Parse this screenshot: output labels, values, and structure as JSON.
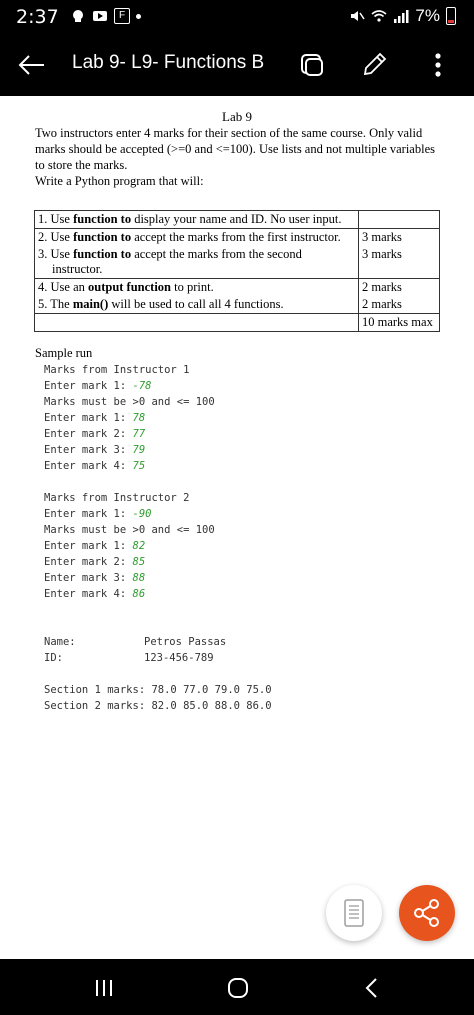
{
  "status_bar": {
    "time": "2:37",
    "f_badge": "F",
    "battery": "7%"
  },
  "app_bar": {
    "title": "Lab 9- L9- Functions B"
  },
  "document": {
    "heading": "Lab 9",
    "intro_lines": [
      "Two instructors enter 4 marks for their section of the same course. Only valid",
      "marks should be accepted (>=0 and <=100). Use lists and not multiple variables",
      "to store the marks.",
      "Write a Python program that will:"
    ],
    "tasks": [
      {
        "pre": "1. Use ",
        "bold": "function to",
        "post": " display your name and ID. No user input.",
        "marks": ""
      },
      {
        "pre": "2. Use ",
        "bold": "function to",
        "post": " accept the marks from the first instructor.",
        "marks": "3 marks"
      },
      {
        "pre": "3. Use ",
        "bold": "function to",
        "post": " accept the marks from the second",
        "cont": "instructor.",
        "marks": "3 marks"
      },
      {
        "pre": "4. Use an ",
        "bold": "output function",
        "post": " to print.",
        "marks": "2 marks"
      },
      {
        "pre": "5. The ",
        "bold": "main()",
        "post": " will be used to call all 4 functions.",
        "marks": "2 marks"
      }
    ],
    "total_marks": "10 marks max",
    "sample_label": "Sample run",
    "run1": {
      "header": "Marks from Instructor 1",
      "prompt1": "Enter mark 1: ",
      "val1": "-78",
      "error": "Marks must be >0 and <= 100",
      "prompt1b": "Enter mark 1: ",
      "val1b": "78",
      "prompt2": "Enter mark 2: ",
      "val2": "77",
      "prompt3": "Enter mark 3: ",
      "val3": "79",
      "prompt4": "Enter mark 4: ",
      "val4": "75"
    },
    "run2": {
      "header": "Marks from Instructor 2",
      "prompt1": "Enter mark 1: ",
      "val1": "-90",
      "error": "Marks must be >0 and <= 100",
      "prompt1b": "Enter mark 1: ",
      "val1b": "82",
      "prompt2": "Enter mark 2: ",
      "val2": "85",
      "prompt3": "Enter mark 3: ",
      "val3": "88",
      "prompt4": "Enter mark 4: ",
      "val4": "86"
    },
    "info": {
      "name_label": "Name:",
      "name_value": "Petros Passas",
      "id_label": "ID:",
      "id_value": "123-456-789"
    },
    "summary": {
      "section1": "Section 1 marks: 78.0 77.0 79.0 75.0",
      "section2": "Section 2 marks: 82.0 85.0 88.0 86.0"
    }
  },
  "colors": {
    "share_fab": "#e8541e",
    "code_input": "#2e9e2e"
  }
}
